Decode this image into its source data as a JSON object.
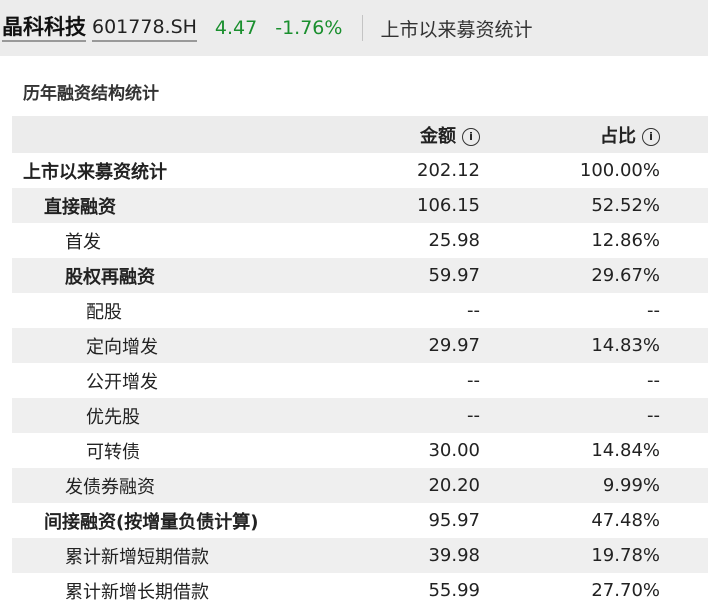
{
  "header": {
    "stock_name": "晶科科技",
    "stock_code": "601778.SH",
    "price": "4.47",
    "change": "-1.76%",
    "page_label": "上市以来募资统计"
  },
  "section": {
    "title": "历年融资结构统计",
    "col_amount": "金额",
    "col_ratio": "占比",
    "info_glyph": "①"
  },
  "rows": [
    {
      "label": "上市以来募资统计",
      "amount": "202.12",
      "ratio": "100.00%"
    },
    {
      "label": "直接融资",
      "amount": "106.15",
      "ratio": "52.52%"
    },
    {
      "label": "首发",
      "amount": "25.98",
      "ratio": "12.86%"
    },
    {
      "label": "股权再融资",
      "amount": "59.97",
      "ratio": "29.67%"
    },
    {
      "label": "配股",
      "amount": "--",
      "ratio": "--"
    },
    {
      "label": "定向增发",
      "amount": "29.97",
      "ratio": "14.83%"
    },
    {
      "label": "公开增发",
      "amount": "--",
      "ratio": "--"
    },
    {
      "label": "优先股",
      "amount": "--",
      "ratio": "--"
    },
    {
      "label": "可转债",
      "amount": "30.00",
      "ratio": "14.84%"
    },
    {
      "label": "发债券融资",
      "amount": "20.20",
      "ratio": "9.99%"
    },
    {
      "label": "间接融资(按增量负债计算)",
      "amount": "95.97",
      "ratio": "47.48%"
    },
    {
      "label": "累计新增短期借款",
      "amount": "39.98",
      "ratio": "19.78%"
    },
    {
      "label": "累计新增长期借款",
      "amount": "55.99",
      "ratio": "27.70%"
    }
  ],
  "colors": {
    "up_down": "#1a8f2e",
    "header_bg": "#ececec",
    "stripe": "#efefef"
  }
}
